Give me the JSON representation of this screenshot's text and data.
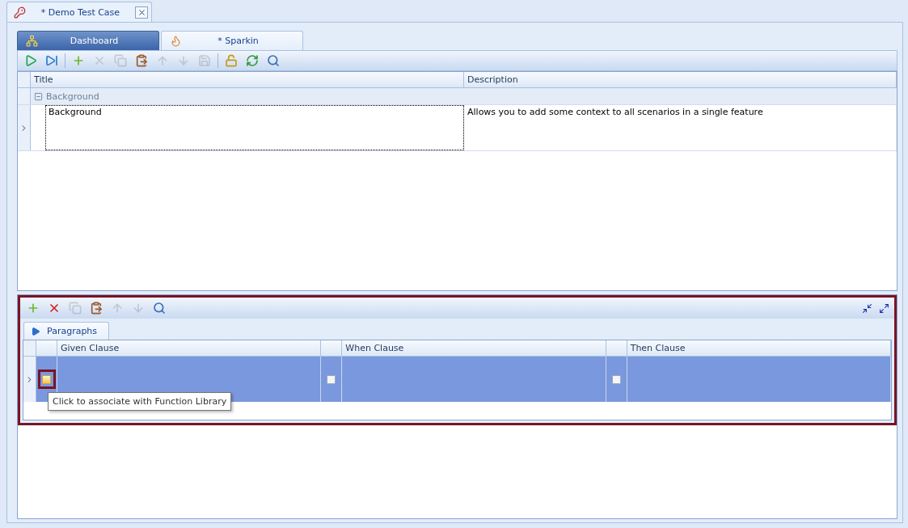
{
  "document_tabs": [
    {
      "label": "* Demo Test Case",
      "selected": true
    }
  ],
  "view_tabs": [
    {
      "label": "Dashboard",
      "selected": false,
      "kind": "dashboard"
    },
    {
      "label": "* Sparkin",
      "selected": true,
      "kind": "flame"
    }
  ],
  "toolbar": [
    {
      "kind": "run",
      "disabled": false
    },
    {
      "kind": "step",
      "disabled": false
    },
    {
      "kind": "separator"
    },
    {
      "kind": "add",
      "disabled": false
    },
    {
      "kind": "delete",
      "disabled": true
    },
    {
      "kind": "copy",
      "disabled": true
    },
    {
      "kind": "paste",
      "disabled": false
    },
    {
      "kind": "up",
      "disabled": true
    },
    {
      "kind": "down",
      "disabled": true
    },
    {
      "kind": "save",
      "disabled": true
    },
    {
      "kind": "separator"
    },
    {
      "kind": "lock",
      "disabled": false
    },
    {
      "kind": "refresh",
      "disabled": false
    },
    {
      "kind": "search",
      "disabled": false
    }
  ],
  "scenario_grid": {
    "columns": [
      "Title",
      "Description"
    ],
    "groups": [
      {
        "label": "Background",
        "expanded": true,
        "rows": [
          {
            "title": "Background",
            "description": "Allows you to add some context to all scenarios in a single feature",
            "selected": true
          }
        ]
      }
    ]
  },
  "steps_panel": {
    "toolbar": [
      {
        "kind": "add",
        "disabled": false
      },
      {
        "kind": "delete",
        "disabled": false
      },
      {
        "kind": "copy",
        "disabled": true
      },
      {
        "kind": "paste",
        "disabled": false
      },
      {
        "kind": "up",
        "disabled": true
      },
      {
        "kind": "down",
        "disabled": true
      },
      {
        "kind": "search",
        "disabled": false
      }
    ],
    "tabs": [
      {
        "label": "Paragraphs",
        "selected": true
      }
    ],
    "columns": [
      "Given Clause",
      "When Clause",
      "Then Clause"
    ],
    "rows": [
      {
        "selected": true,
        "cells": [
          {
            "focused": true
          },
          {
            "focused": false
          },
          {
            "focused": false
          }
        ]
      }
    ],
    "tooltip": "Click to associate with Function Library"
  }
}
